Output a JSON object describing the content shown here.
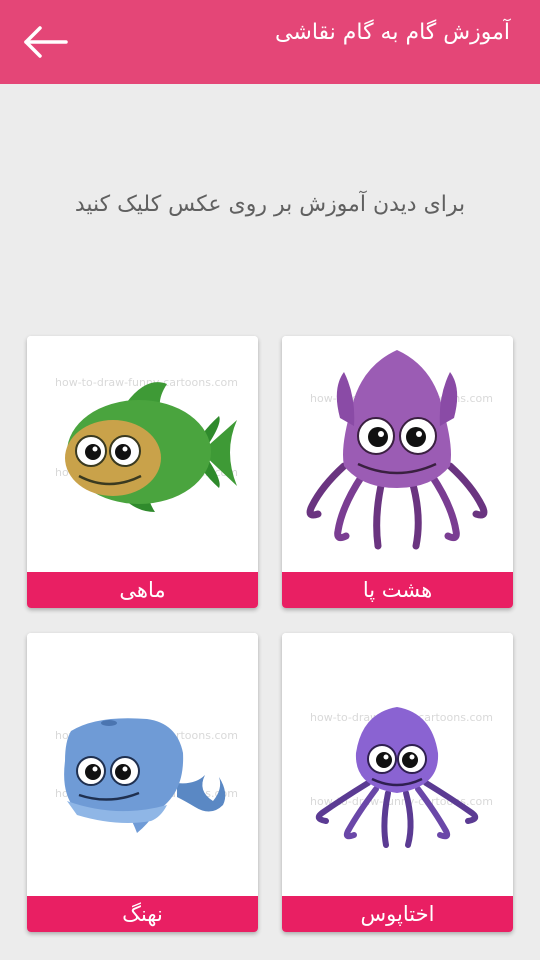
{
  "header": {
    "title": "آموزش گام به گام نقاشی",
    "back_icon": "arrow-left-icon"
  },
  "instruction": "برای دیدن آموزش بر روی عکس کلیک کنید",
  "cards": [
    {
      "label": "هشت پا",
      "watermark": "how-to-draw-funny-cartoons.com",
      "image": "purple-squid"
    },
    {
      "label": "ماهی",
      "watermark": "how-to-draw-funny-cartoons.com",
      "image": "green-fish"
    },
    {
      "label": "اختاپوس",
      "watermark": "how-to-draw-funny-cartoons.com",
      "image": "violet-octopus"
    },
    {
      "label": "نهنگ",
      "watermark": "how-to-draw-funny-cartoons.com",
      "image": "blue-whale"
    }
  ],
  "colors": {
    "appbar": "#e44677",
    "card_label": "#e91f63",
    "background": "#ececec"
  }
}
